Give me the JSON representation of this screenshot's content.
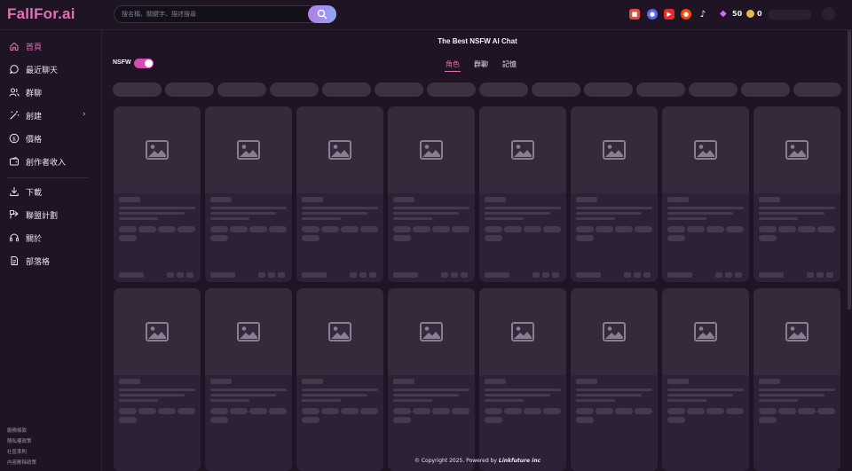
{
  "brand": {
    "logo": "FallFor.ai",
    "accent": "#e56fb4"
  },
  "search": {
    "placeholder": "搜名稱、關鍵字、描述搜尋"
  },
  "header": {
    "socials": [
      "gift-icon",
      "discord-icon",
      "youtube-icon",
      "reddit-icon",
      "tiktok-icon"
    ],
    "gems": "50",
    "coins": "0"
  },
  "sidebar": {
    "items": [
      {
        "label": "首頁",
        "icon": "home-icon",
        "active": true
      },
      {
        "label": "最近聊天",
        "icon": "chat-icon"
      },
      {
        "label": "群聊",
        "icon": "group-icon"
      },
      {
        "label": "創建",
        "icon": "magic-wand-icon",
        "has_submenu": true
      },
      {
        "label": "價格",
        "icon": "dollar-icon"
      },
      {
        "label": "創作者收入",
        "icon": "wallet-icon"
      },
      {
        "label": "下載",
        "icon": "download-icon"
      },
      {
        "label": "聯盟計劃",
        "icon": "share-icon"
      },
      {
        "label": "關於",
        "icon": "headset-icon"
      },
      {
        "label": "部落格",
        "icon": "document-icon"
      }
    ],
    "footer_links": [
      "服務條款",
      "隱私權政策",
      "社區準則",
      "內容刪除政策"
    ]
  },
  "main": {
    "title": "The Best NSFW AI Chat",
    "nsfw_label": "NSFW",
    "nsfw_enabled": true,
    "tabs": [
      {
        "label": "角色",
        "active": true
      },
      {
        "label": "群聊"
      },
      {
        "label": "記憶"
      }
    ]
  },
  "footer": {
    "copyright_prefix": "© Copyright 2025. Powered by",
    "company": "Linkfuture inc"
  }
}
